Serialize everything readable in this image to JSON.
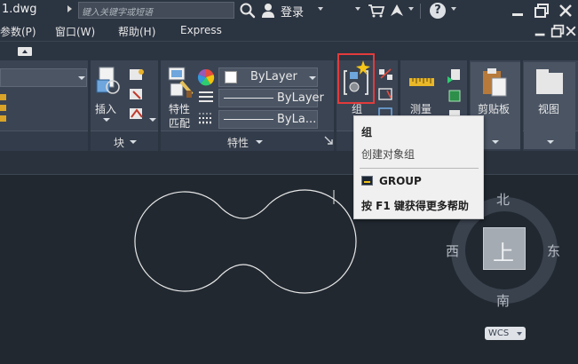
{
  "titlebar": {
    "file_name": "1.dwg",
    "search_placeholder": "键入关键字或短语",
    "login_label": "登录"
  },
  "menu": {
    "items": [
      "参数(P)",
      "窗口(W)",
      "帮助(H)",
      "Express"
    ]
  },
  "ribbon": {
    "insert_label": "插入",
    "block_panel_title": "块",
    "match_props_label_1": "特性",
    "match_props_label_2": "匹配",
    "properties_panel_title": "特性",
    "color_dropdown": "ByLayer",
    "linetype_dropdown": "ByLayer",
    "lineweight_dropdown": "ByLa...",
    "group_label": "组",
    "measure_label": "测量",
    "clipboard_label": "剪贴板",
    "view_label": "视图"
  },
  "tooltip": {
    "title": "组",
    "description": "创建对象组",
    "command": "GROUP",
    "help_hint": "按 F1 键获得更多帮助"
  },
  "viewcube": {
    "north": "北",
    "south": "南",
    "east": "东",
    "west": "西",
    "face": "上",
    "wcs_label": "WCS"
  },
  "colors": {
    "titlebar_bg": "#2b3441",
    "ribbon_bg": "#3b4453",
    "canvas_bg": "#212830",
    "highlight": "#e23b3b",
    "tooltip_bg": "#f0f0f0"
  },
  "icons": [
    "search-icon",
    "user-icon",
    "cart-icon",
    "share-icon",
    "help-icon",
    "minimize-icon",
    "restore-icon",
    "close-icon",
    "insert-block-icon",
    "match-properties-icon",
    "color-wheel-icon",
    "group-icon",
    "measure-icon",
    "paste-icon",
    "view-icon"
  ]
}
